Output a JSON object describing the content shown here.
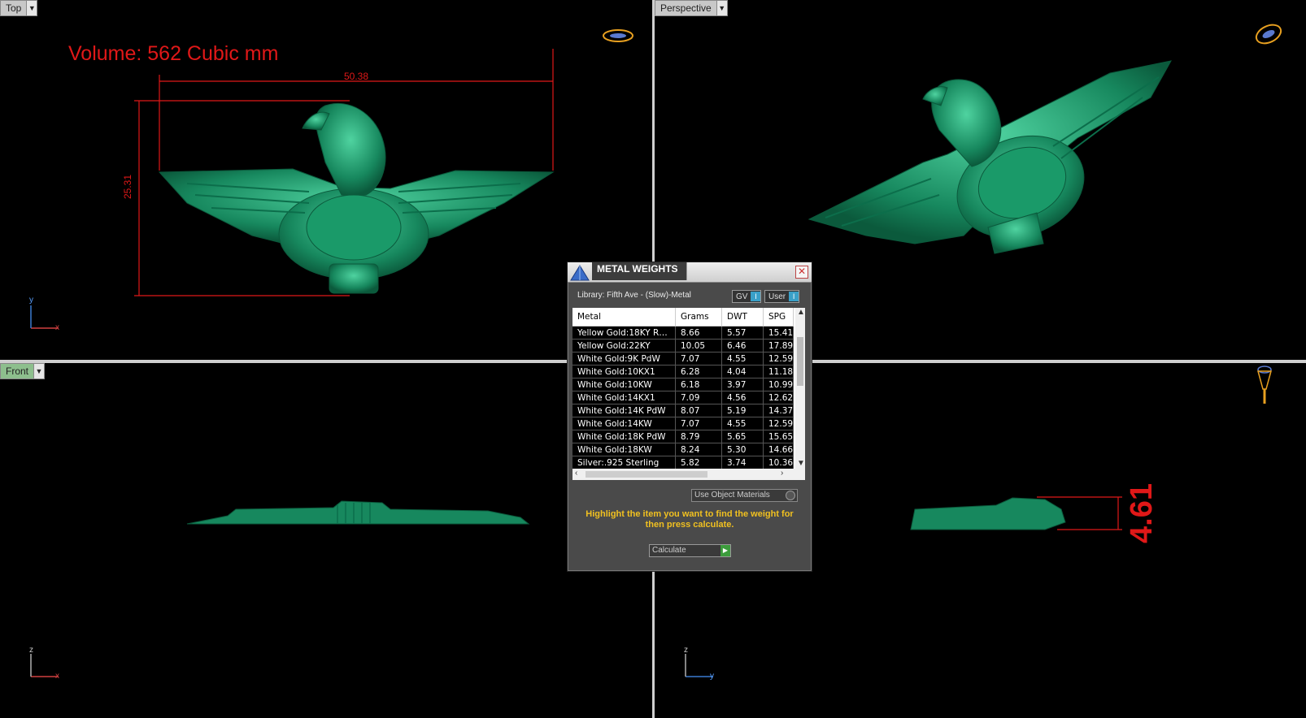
{
  "viewports": {
    "top": {
      "label": "Top",
      "volume_text": "Volume: 562 Cubic mm",
      "dim_width": "50.38",
      "dim_height": "25.31",
      "axis_x": "x",
      "axis_y": "y"
    },
    "perspective": {
      "label": "Perspective"
    },
    "front": {
      "label": "Front",
      "axis_x": "x",
      "axis_z": "z"
    },
    "right": {
      "dim_depth": "4.61",
      "axis_y": "y",
      "axis_z": "z"
    }
  },
  "dialog": {
    "title": "METAL WEIGHTS",
    "close": "✕",
    "library": "Library: Fifth Ave - (Slow)-Metal",
    "toggle_gv": "GV",
    "toggle_user": "User",
    "toggle_mark": "I",
    "columns": [
      "Metal",
      "Grams",
      "DWT",
      "SPG"
    ],
    "rows": [
      [
        "Yellow Gold:18KY R…",
        "8.66",
        "5.57",
        "15.41"
      ],
      [
        "Yellow Gold:22KY",
        "10.05",
        "6.46",
        "17.89"
      ],
      [
        "White Gold:9K PdW",
        "7.07",
        "4.55",
        "12.59"
      ],
      [
        "White Gold:10KX1",
        "6.28",
        "4.04",
        "11.18"
      ],
      [
        "White Gold:10KW",
        "6.18",
        "3.97",
        "10.99"
      ],
      [
        "White Gold:14KX1",
        "7.09",
        "4.56",
        "12.62"
      ],
      [
        "White Gold:14K PdW",
        "8.07",
        "5.19",
        "14.37"
      ],
      [
        "White Gold:14KW",
        "7.07",
        "4.55",
        "12.59"
      ],
      [
        "White Gold:18K PdW",
        "8.79",
        "5.65",
        "15.65"
      ],
      [
        "White Gold:18KW",
        "8.24",
        "5.30",
        "14.66"
      ],
      [
        "Silver:.925 Sterling",
        "5.82",
        "3.74",
        "10.36"
      ]
    ],
    "use_object_materials": "Use Object Materials",
    "hint": "Highlight the item you want to find the weight for then press calculate.",
    "calculate": "Calculate"
  },
  "colors": {
    "model": "#17885e",
    "dimension": "#e01818",
    "gizmo": "#e8a020"
  }
}
